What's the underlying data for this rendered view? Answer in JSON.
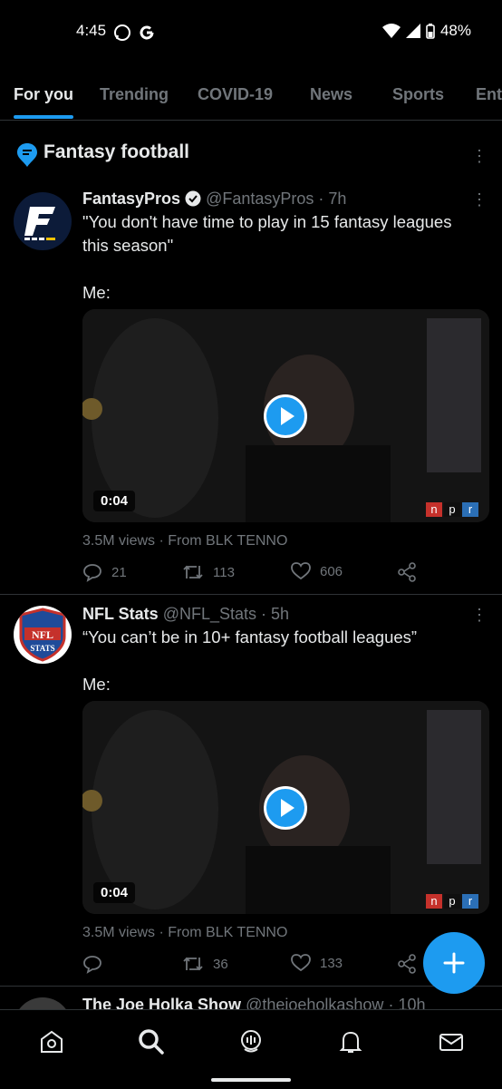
{
  "status_bar": {
    "time": "4:45",
    "battery": "48%"
  },
  "tabs": [
    {
      "label": "For you",
      "active": true
    },
    {
      "label": "Trending",
      "active": false
    },
    {
      "label": "COVID-19",
      "active": false
    },
    {
      "label": "News",
      "active": false
    },
    {
      "label": "Sports",
      "active": false
    },
    {
      "label": "Ent",
      "active": false
    }
  ],
  "topic": {
    "title": "Fantasy football"
  },
  "tweets": [
    {
      "name": "FantasyPros",
      "handle": "@FantasyPros",
      "time": "7h",
      "verified": true,
      "text_lines": [
        "\"You don't have time to play in 15 fantasy leagues",
        "this season\""
      ],
      "text_extra": "Me:",
      "video_duration": "0:04",
      "views": "3.5M views",
      "source": "From BLK TENNO",
      "replies": "21",
      "retweets": "113",
      "likes": "606"
    },
    {
      "name": "NFL Stats",
      "handle": "@NFL_Stats",
      "time": "5h",
      "verified": false,
      "text_lines": [
        "“You can’t be in 10+ fantasy football leagues”"
      ],
      "text_extra": "Me:",
      "video_duration": "0:04",
      "views": "3.5M views",
      "source": "From BLK TENNO",
      "replies": "",
      "retweets": "36",
      "likes": "133"
    },
    {
      "name": "The Joe Holka Show",
      "handle": "@thejoeholkashow",
      "time": "10h"
    }
  ],
  "npr_letters": [
    "n",
    "p",
    "r"
  ],
  "colors": {
    "accent": "#1d9bf0",
    "muted": "#71767b",
    "text": "#e7e9ea",
    "npr_red": "#c5312b",
    "npr_blue": "#2b6fb6"
  },
  "icons": {
    "nav": [
      "home-icon",
      "search-icon",
      "spaces-icon",
      "notifications-icon",
      "messages-icon"
    ],
    "fab": "compose-plus-icon"
  }
}
